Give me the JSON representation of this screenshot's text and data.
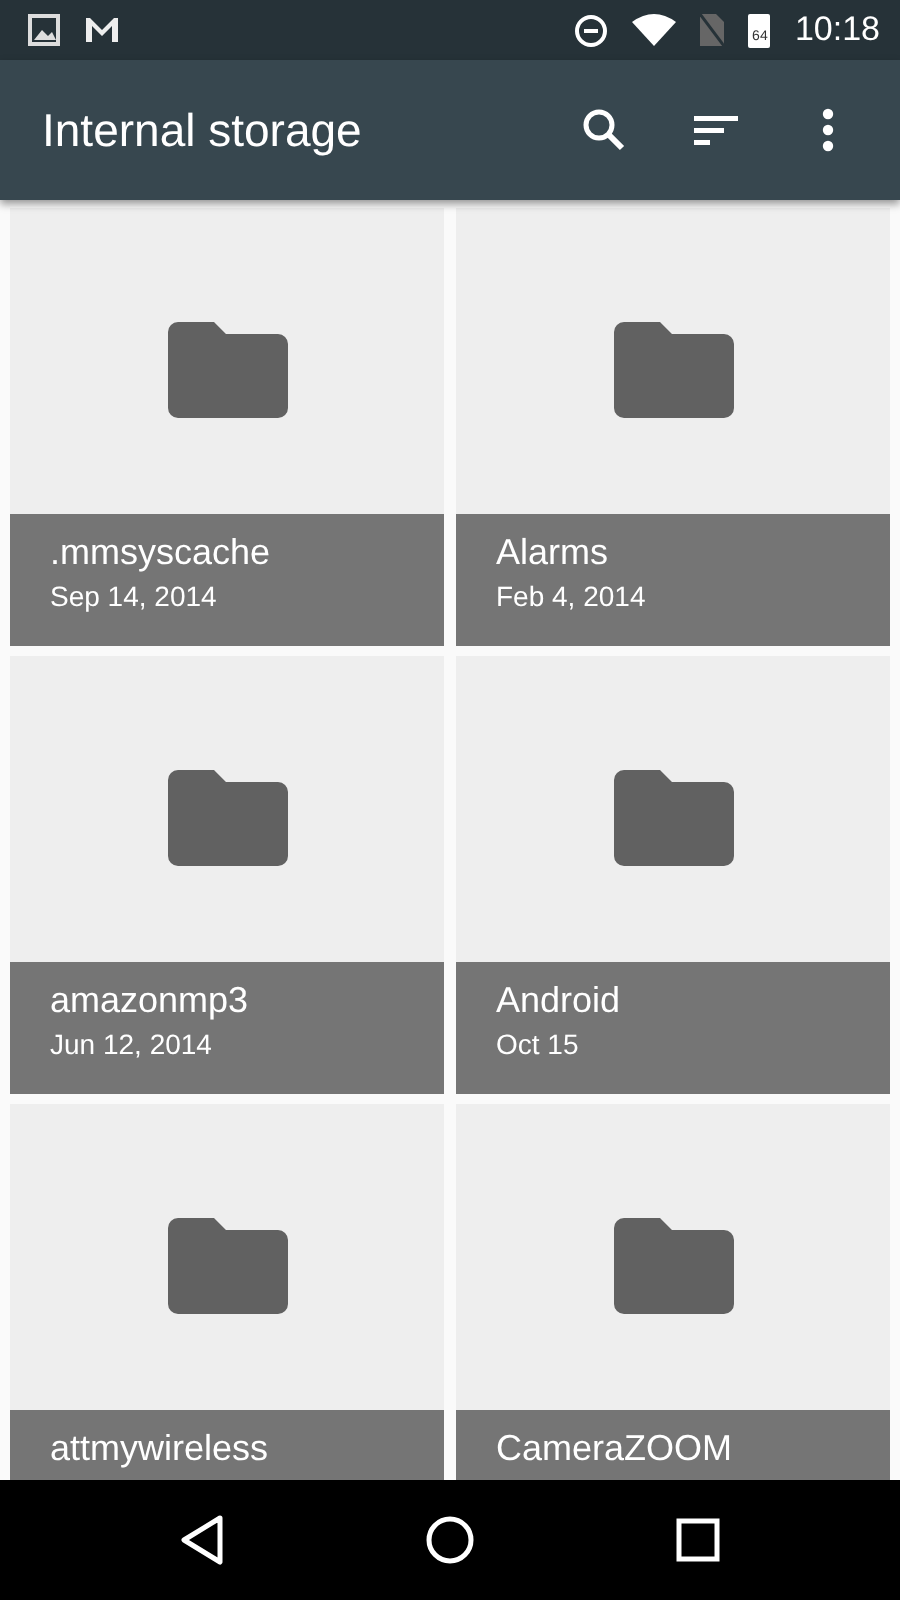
{
  "status_bar": {
    "time": "10:18",
    "battery": "64"
  },
  "app_bar": {
    "title": "Internal storage"
  },
  "folders": [
    {
      "name": ".mmsyscache",
      "date": "Sep 14, 2014"
    },
    {
      "name": "Alarms",
      "date": "Feb 4, 2014"
    },
    {
      "name": "amazonmp3",
      "date": "Jun 12, 2014"
    },
    {
      "name": "Android",
      "date": "Oct 15"
    },
    {
      "name": "attmywireless"
    },
    {
      "name": "CameraZOOM"
    }
  ]
}
